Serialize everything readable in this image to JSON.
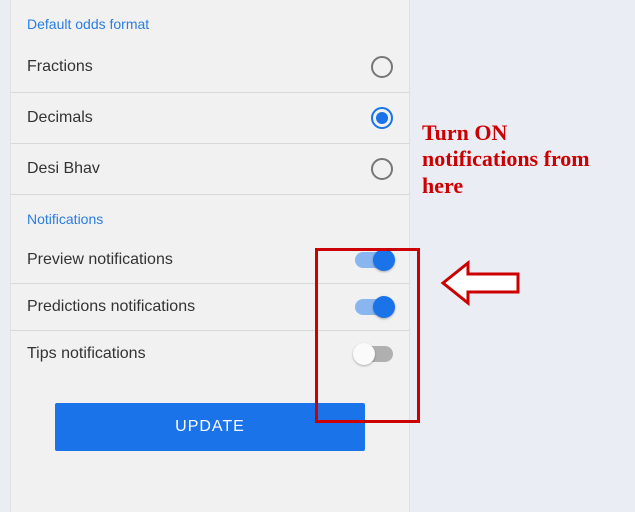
{
  "sections": {
    "odds_title": "Default odds format",
    "notifications_title": "Notifications"
  },
  "odds_options": {
    "fractions": {
      "label": "Fractions",
      "selected": false
    },
    "decimals": {
      "label": "Decimals",
      "selected": true
    },
    "desi_bhav": {
      "label": "Desi Bhav",
      "selected": false
    }
  },
  "notification_options": {
    "preview": {
      "label": "Preview notifications",
      "on": true
    },
    "predictions": {
      "label": "Predictions notifications",
      "on": true
    },
    "tips": {
      "label": "Tips notifications",
      "on": false
    }
  },
  "update_button": "UPDATE",
  "annotation": "Turn ON notifications from here",
  "colors": {
    "accent": "#1a73e8",
    "anno": "#cc0000"
  }
}
